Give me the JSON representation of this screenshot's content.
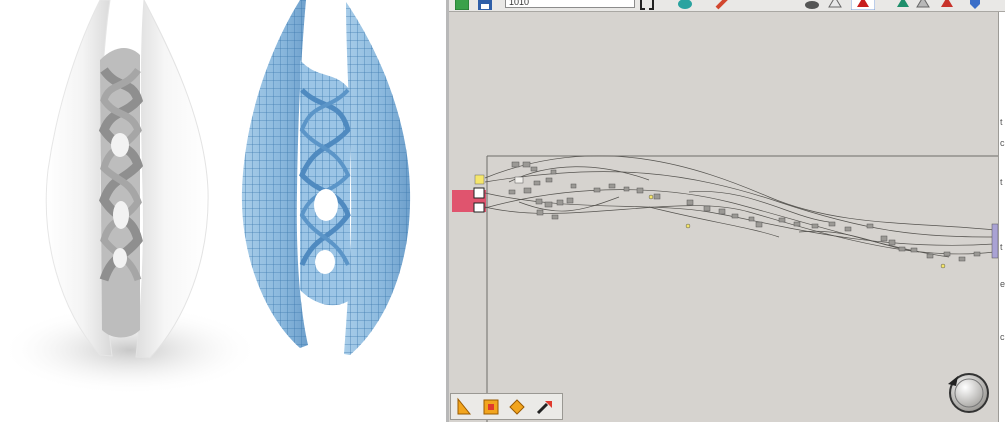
{
  "render_viewport": {
    "label": "rhino-render-viewport",
    "models": [
      "white-shaded-shell-model",
      "blue-wireframe-shell-model"
    ],
    "colors": {
      "shell_white": "#f4f4f4",
      "wire_blue": "#8ab8dd",
      "wire_line": "#3f7bb0"
    }
  },
  "grasshopper": {
    "toolbar": {
      "file_field_value": "1010",
      "icons": [
        "new-document-icon",
        "save-icon",
        "zoom-extents-icon",
        "sketch-icon",
        "brush-icon",
        "preview-off-icon",
        "preview-wire-icon",
        "preview-shaded-icon",
        "selected-preview-icon",
        "material-icon",
        "bake-icon",
        "shield-icon"
      ]
    },
    "colors": {
      "canvas": "#d6d3cf",
      "group_fill": "#e0546e",
      "panel_yellow": "#f5e66b",
      "output_purple": "#a9a2d4"
    },
    "right_edge_letters": [
      "t",
      "c",
      "t",
      "t",
      "e",
      "c"
    ],
    "palette_tools": [
      "sketch-tool-icon",
      "group-tool-icon",
      "cluster-tool-icon",
      "scribble-tool-icon"
    ],
    "navigator": "zoom-navigator-icon"
  }
}
